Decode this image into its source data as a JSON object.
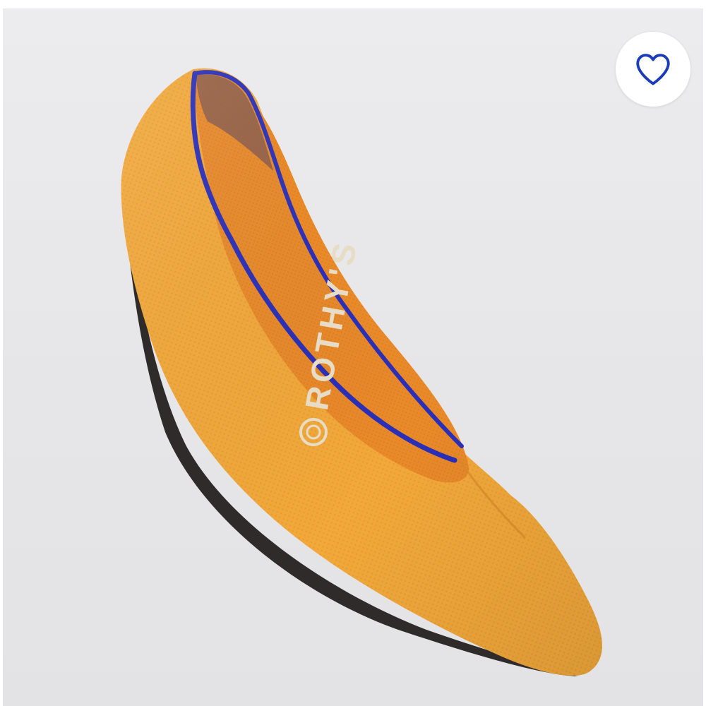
{
  "product": {
    "insole_brand": "ROTHY'S",
    "colors": {
      "knit": "#F2A93B",
      "knit_shadow": "#E08C22",
      "insole": "#E98A2A",
      "binding": "#2A2FB8",
      "lining": "#8A5A4A",
      "sole": "#2E2B2A",
      "logo_thread": "#E7DCC6",
      "background": "#E8E8EA"
    }
  },
  "favorite": {
    "icon": "heart-outline-icon",
    "color": "#1A3CB8"
  }
}
